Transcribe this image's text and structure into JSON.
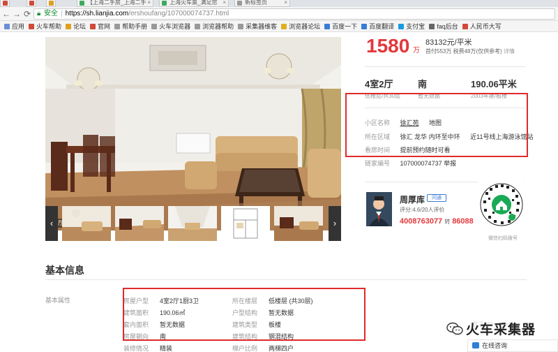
{
  "browser": {
    "tabs": [
      {
        "title": "【上海二手房_上海二手"
      },
      {
        "title": "上海火车票_满足您"
      },
      {
        "title": "新标签页"
      }
    ],
    "address": {
      "secure_label": "安全",
      "host": "https://sh.lianjia.com",
      "path": "/ershoufang/107000074737.html"
    },
    "bookmarks": [
      {
        "label": "应用",
        "color": "#6b8ed6"
      },
      {
        "label": "火车帮助",
        "color": "#d04a3a"
      },
      {
        "label": "论坛",
        "color": "#e0a020"
      },
      {
        "label": "官网",
        "color": "#d04a3a"
      },
      {
        "label": "帮助手册",
        "color": "#999999"
      },
      {
        "label": "火车浏览器",
        "color": "#999999"
      },
      {
        "label": "浏览器帮助",
        "color": "#999999"
      },
      {
        "label": "采集器维客",
        "color": "#999999"
      },
      {
        "label": "浏览器论坛",
        "color": "#e0b020"
      },
      {
        "label": "百度一下",
        "color": "#3a7bd5"
      },
      {
        "label": "百度翻译",
        "color": "#3a7bd5"
      },
      {
        "label": "支付宝",
        "color": "#1a9be0"
      },
      {
        "label": "faq后台",
        "color": "#666666"
      },
      {
        "label": "人民币大写",
        "color": "#d04a3a"
      }
    ]
  },
  "listing": {
    "photo_label": "客厅",
    "price": "1580",
    "price_unit": "万",
    "unit_price": "83132元/平米",
    "down_payment": "首付553万 税费48万(仅供参考)",
    "detail_link": "详情",
    "stats": [
      {
        "main": "4室2厅",
        "sub": "低楼层/共30层"
      },
      {
        "main": "南",
        "sub": "暂无数据"
      },
      {
        "main": "190.06平米",
        "sub": "2003年建/板楼"
      }
    ],
    "community": {
      "label": "小区名称",
      "name": "徐汇苑",
      "map": "地图"
    },
    "area": {
      "label": "所在区域",
      "district": "徐汇",
      "sub": "龙华",
      "ring": "内环至中环",
      "metro": "近11号线上海游泳馆站"
    },
    "visit": {
      "label": "看房时间",
      "value": "提前预约随时可看"
    },
    "code": {
      "label": "链家编号",
      "value": "107000074737",
      "report": "举报"
    }
  },
  "agent": {
    "name": "周厚库",
    "chat": "问通",
    "score": "评分:4.6/20人评价",
    "phone": "4008763077",
    "ext_label": "转",
    "ext": "86088",
    "qr_caption": "微信扫码拨号"
  },
  "basic": {
    "title": "基本信息",
    "section_label": "基本属性",
    "rows_left": [
      {
        "k": "房屋户型",
        "v": "4室2厅1厨3卫"
      },
      {
        "k": "建筑面积",
        "v": "190.06㎡"
      },
      {
        "k": "套内面积",
        "v": "暂无数据"
      },
      {
        "k": "房屋朝向",
        "v": "南"
      },
      {
        "k": "装修情况",
        "v": "精装"
      }
    ],
    "rows_right": [
      {
        "k": "所在楼层",
        "v": "低楼层 (共30层)"
      },
      {
        "k": "户型结构",
        "v": "暂无数据"
      },
      {
        "k": "建筑类型",
        "v": "板楼"
      },
      {
        "k": "建筑结构",
        "v": "钢混结构"
      },
      {
        "k": "梯户比例",
        "v": "两梯四户"
      }
    ]
  },
  "overlay": {
    "watermark": "激活 Windows",
    "brand": "火车采集器",
    "consult": "在线咨询"
  }
}
